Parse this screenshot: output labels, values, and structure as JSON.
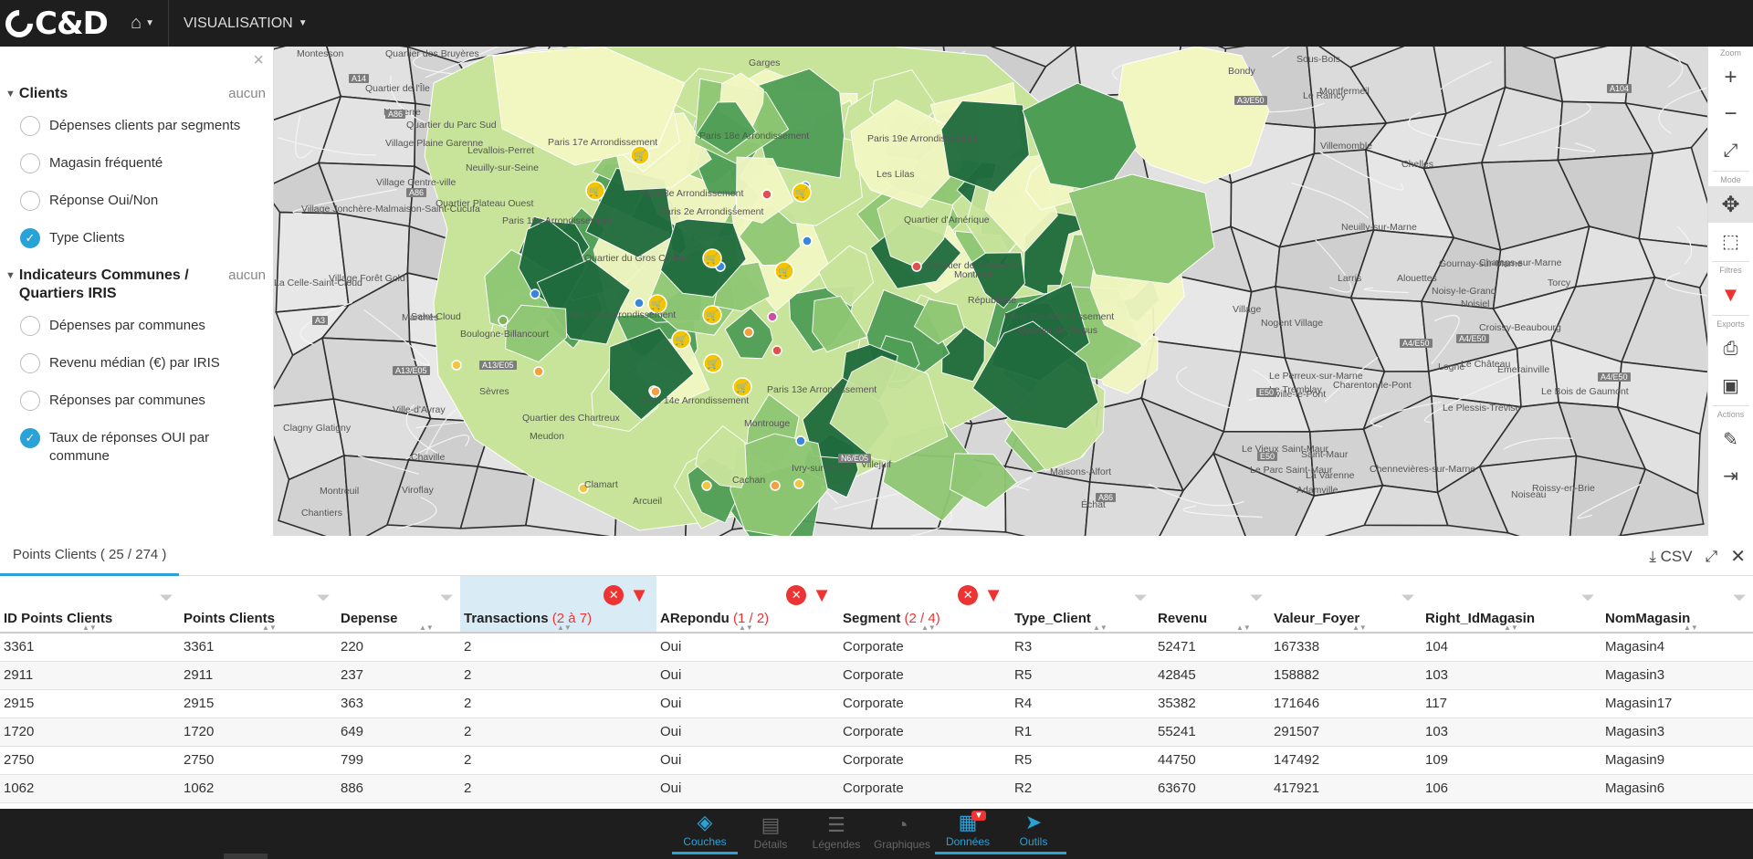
{
  "app": {
    "logo_text": "C&D",
    "menu_label": "VISUALISATION"
  },
  "left_panel": {
    "close_glyph": "×",
    "groups": [
      {
        "title": "Clients",
        "status": "aucun",
        "items": [
          {
            "label": "Dépenses clients par segments",
            "checked": false
          },
          {
            "label": "Magasin fréquenté",
            "checked": false
          },
          {
            "label": "Réponse Oui/Non",
            "checked": false
          },
          {
            "label": "Type Clients",
            "checked": true
          }
        ]
      },
      {
        "title": "Indicateurs Communes / Quartiers IRIS",
        "status": "aucun",
        "items": [
          {
            "label": "Dépenses par communes",
            "checked": false
          },
          {
            "label": "Revenu médian (€) par IRIS",
            "checked": false
          },
          {
            "label": "Réponses par communes",
            "checked": false
          },
          {
            "label": "Taux de réponses OUI par commune",
            "checked": true
          }
        ]
      }
    ]
  },
  "map": {
    "labels": [
      "Montesson",
      "Quartier des Bruyères",
      "Quartier de l'Île",
      "Nanterre",
      "Quartier du Parc Sud",
      "Village Plaine Garenne",
      "Village Centre-ville",
      "Village Jonchère-Malmaison-Saint-Cucufa",
      "Village Forêt Gold",
      "La Celle-Saint-Cloud",
      "Marches",
      "Quartier Plateau Ouest",
      "Saint-Cloud",
      "Neuilly-sur-Seine",
      "Levallois-Perret",
      "Paris 17e Arrondissement",
      "Paris 18e Arrondissement",
      "Paris 8e Arrondissement",
      "Paris 2e Arrondissement",
      "Paris 16e Arrondissement",
      "Quartier du Gros Caillou",
      "Paris 15e Arrondissement",
      "Paris 14e Arrondissement",
      "Paris 13e Arrondissement",
      "Boulogne-Billancourt",
      "Quartier des Chartreux",
      "Sèvres",
      "Ville-d'Avray",
      "Clagny Glatigny",
      "Chaville",
      "Meudon",
      "Montreuil",
      "Viroflay",
      "Chantiers",
      "Clamart",
      "Montrouge",
      "Arcueil",
      "Cachan",
      "Villejuif",
      "Ivry-sur-Seine",
      "Quartier d'Amérique",
      "Quartier de Charonne",
      "Montreuil",
      "Les Lilas",
      "Bondy",
      "Le Raincy",
      "Montfermeil",
      "Villemomble",
      "Chelles",
      "Neuilly-sur-Marne",
      "Gournay-sur-Marne",
      "Champs-sur-Marne",
      "Noisy-le-Grand",
      "Noisiel",
      "Torcy",
      "Logne",
      "Croissy-Beaubourg",
      "Larris",
      "Alouettes",
      "Village",
      "Nogent Village",
      "Le Perreux-sur-Marne",
      "Charenton-le-Pont",
      "Joinville-le-Pont",
      "Le Tremblay",
      "Le Château",
      "Le Bois de Gaumont",
      "Le Plessis-Trévise",
      "Émerainville",
      "Le Vieux Saint-Maur",
      "Saint-Maur",
      "Maisons-Alfort",
      "Le Parc Saint-Maur",
      "Chennevières-sur-Marne",
      "Adamville",
      "La Varenne",
      "Échat",
      "Noiseau",
      "Roissy-en-Brie",
      "Sous-Bois",
      "Paris 12e Arrondissement",
      "République",
      "Quartier de Picpus",
      "Paris 19e Arrondissement",
      "Garges"
    ],
    "road_tags": [
      "A14",
      "A86",
      "A86",
      "A13/E05",
      "A13/E05",
      "A3",
      "E50",
      "E50",
      "A4/E50",
      "A4/E50",
      "A4/E50",
      "A86",
      "N6/E05",
      "A104",
      "A3/E50"
    ]
  },
  "toolbar": {
    "sections": [
      {
        "label": "Zoom",
        "buttons": [
          "zoom-in-icon",
          "zoom-out-icon",
          "fullscreen-icon"
        ]
      },
      {
        "label": "Mode",
        "buttons": [
          "pan-icon",
          "select-icon"
        ]
      },
      {
        "label": "Filtres",
        "buttons": [
          "filter-icon"
        ]
      },
      {
        "label": "Exports",
        "buttons": [
          "print-icon",
          "image-icon"
        ]
      },
      {
        "label": "Actions",
        "buttons": [
          "edit-icon",
          "logout-icon"
        ]
      }
    ]
  },
  "data_panel": {
    "tab_label": "Points Clients ( 25 / 274 )",
    "csv_label": "CSV",
    "columns": [
      {
        "name": "ID Points Clients",
        "filter": "",
        "active": false,
        "sorted": false
      },
      {
        "name": "Points Clients",
        "filter": "",
        "active": false,
        "sorted": false
      },
      {
        "name": "Depense",
        "filter": "",
        "active": false,
        "sorted": false
      },
      {
        "name": "Transactions",
        "filter": "(2 à 7)",
        "active": true,
        "sorted": true
      },
      {
        "name": "ARepondu",
        "filter": "(1 / 2)",
        "active": true,
        "sorted": false
      },
      {
        "name": "Segment",
        "filter": "(2 / 4)",
        "active": true,
        "sorted": false
      },
      {
        "name": "Type_Client",
        "filter": "",
        "active": false,
        "sorted": false
      },
      {
        "name": "Revenu",
        "filter": "",
        "active": false,
        "sorted": false
      },
      {
        "name": "Valeur_Foyer",
        "filter": "",
        "active": false,
        "sorted": false
      },
      {
        "name": "Right_IdMagasin",
        "filter": "",
        "active": false,
        "sorted": false
      },
      {
        "name": "NomMagasin",
        "filter": "",
        "active": false,
        "sorted": false
      }
    ],
    "rows": [
      [
        "3361",
        "3361",
        "220",
        "2",
        "Oui",
        "Corporate",
        "R3",
        "52471",
        "167338",
        "104",
        "Magasin4"
      ],
      [
        "2911",
        "2911",
        "237",
        "2",
        "Oui",
        "Corporate",
        "R5",
        "42845",
        "158882",
        "103",
        "Magasin3"
      ],
      [
        "2915",
        "2915",
        "363",
        "2",
        "Oui",
        "Corporate",
        "R4",
        "35382",
        "171646",
        "117",
        "Magasin17"
      ],
      [
        "1720",
        "1720",
        "649",
        "2",
        "Oui",
        "Corporate",
        "R1",
        "55241",
        "291507",
        "103",
        "Magasin3"
      ],
      [
        "2750",
        "2750",
        "799",
        "2",
        "Oui",
        "Corporate",
        "R5",
        "44750",
        "147492",
        "109",
        "Magasin9"
      ],
      [
        "1062",
        "1062",
        "886",
        "2",
        "Oui",
        "Corporate",
        "R2",
        "63670",
        "417921",
        "106",
        "Magasin6"
      ]
    ]
  },
  "bottom_bar": {
    "tabs": [
      {
        "label": "Couches",
        "icon": "layers-icon",
        "active": true
      },
      {
        "label": "Détails",
        "icon": "details-icon",
        "active": false
      },
      {
        "label": "Légendes",
        "icon": "legend-icon",
        "active": false
      },
      {
        "label": "Graphiques",
        "icon": "chart-icon",
        "active": false
      },
      {
        "label": "Données",
        "icon": "table-icon",
        "active": true,
        "badge": "▼"
      },
      {
        "label": "Outils",
        "icon": "cursor-icon",
        "active": true
      }
    ]
  },
  "colors": {
    "accent": "#29a3d7",
    "danger": "#e33333",
    "choropleth": [
      "#f2f7c2",
      "#c8e49b",
      "#8fc774",
      "#4f9e56",
      "#1f6b3d"
    ],
    "marker_store": "#f2c500"
  }
}
